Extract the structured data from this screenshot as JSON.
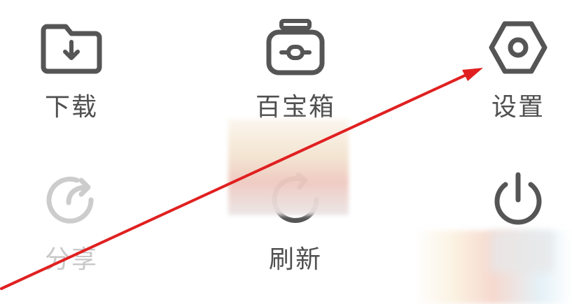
{
  "menu": {
    "items": [
      {
        "id": "download",
        "label": "下载",
        "icon": "download-folder-icon",
        "enabled": true
      },
      {
        "id": "toolbox",
        "label": "百宝箱",
        "icon": "toolbox-icon",
        "enabled": true
      },
      {
        "id": "settings",
        "label": "设置",
        "icon": "hexagon-gear-icon",
        "enabled": true
      },
      {
        "id": "share",
        "label": "分享",
        "icon": "share-arrow-icon",
        "enabled": false
      },
      {
        "id": "refresh",
        "label": "刷新",
        "icon": "refresh-icon",
        "enabled": true
      },
      {
        "id": "exit",
        "label": "",
        "icon": "power-icon",
        "enabled": true
      }
    ]
  },
  "colors": {
    "icon_active": "#555555",
    "icon_disabled": "#cccccc",
    "label_active": "#505050",
    "label_disabled": "#c8c8c8",
    "annotation_arrow": "#e02020"
  }
}
